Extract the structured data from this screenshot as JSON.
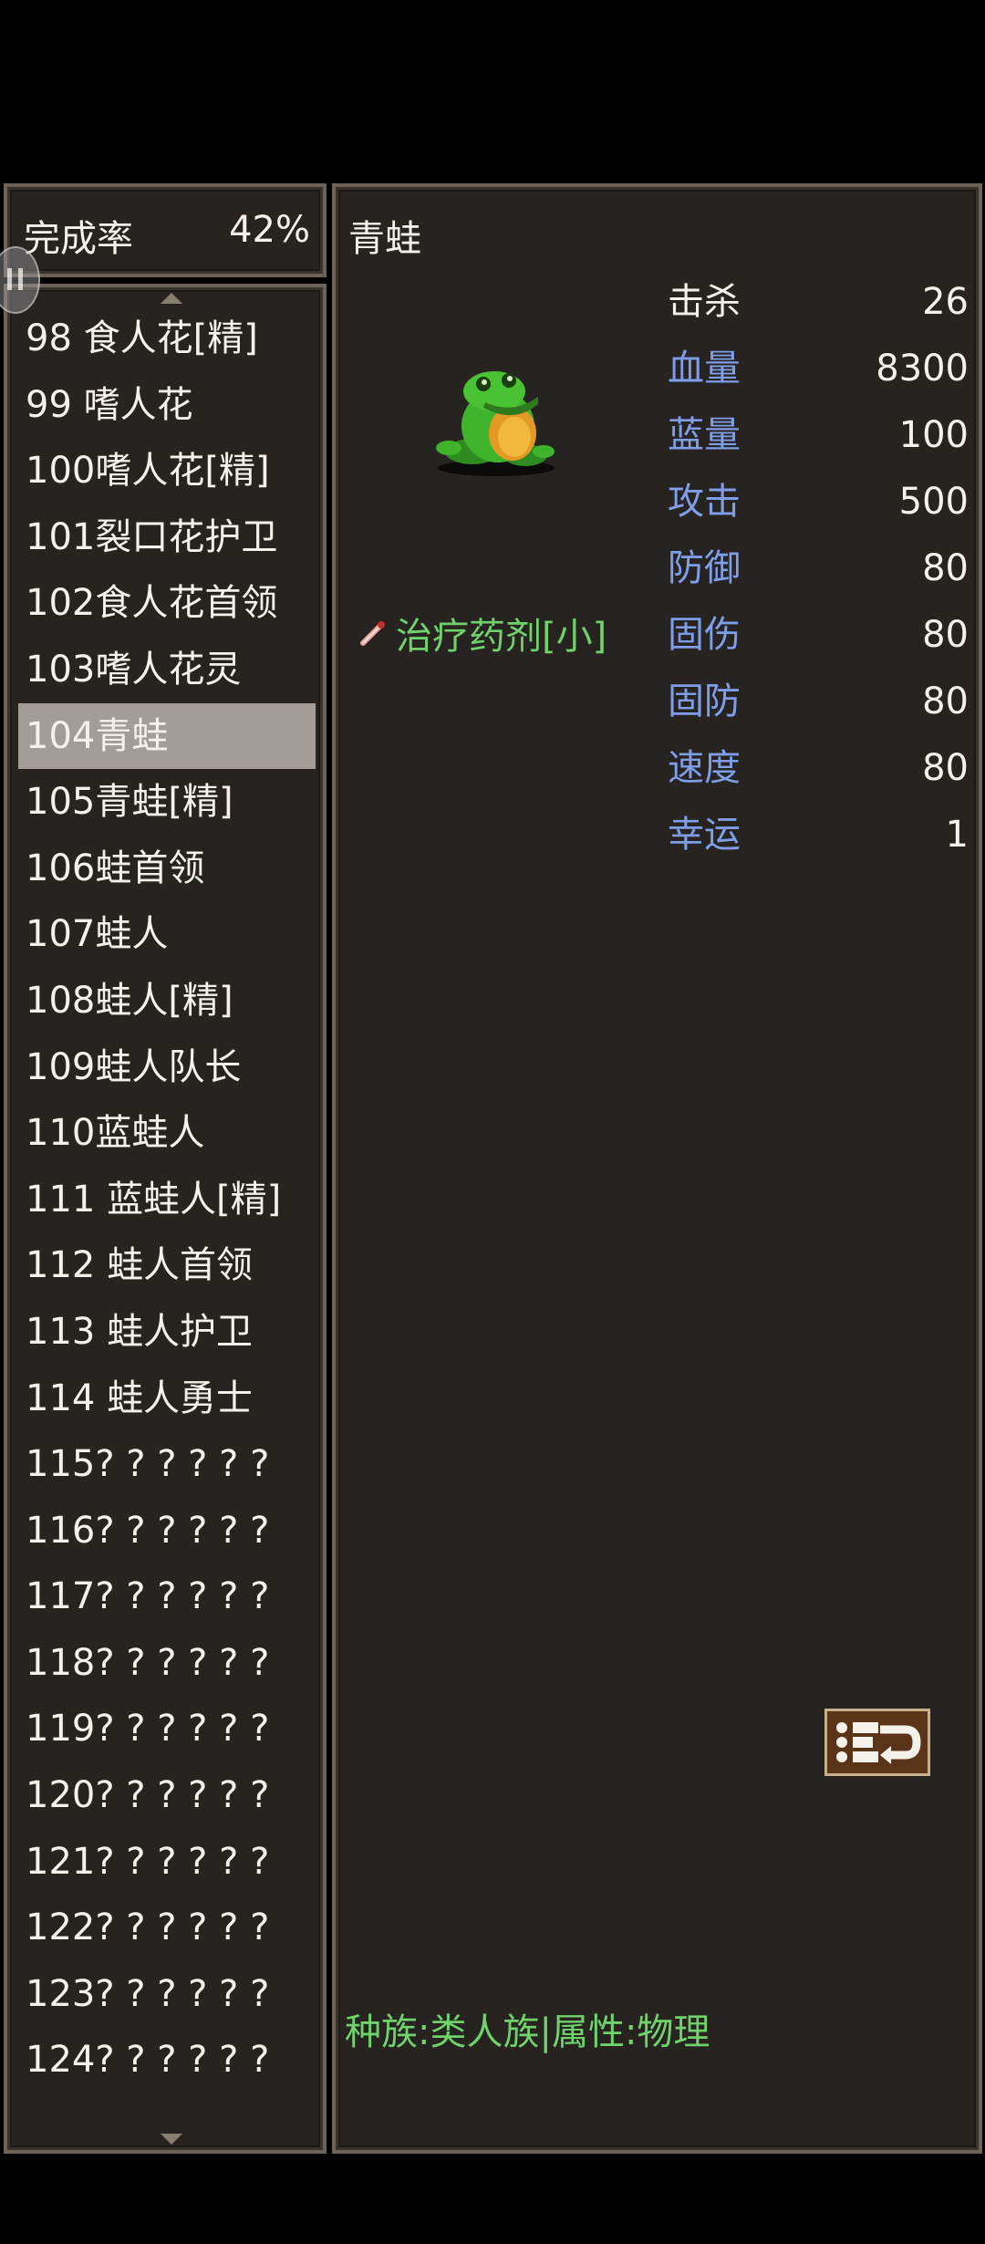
{
  "completion": {
    "label": "完成率",
    "value": "42%"
  },
  "monster_list": [
    "98 食人花[精]",
    "99 嗜人花",
    "100嗜人花[精]",
    "101裂口花护卫",
    "102食人花首领",
    "103嗜人花灵",
    "104青蛙",
    "105青蛙[精]",
    "106蛙首领",
    "107蛙人",
    "108蛙人[精]",
    "109蛙人队长",
    "110蓝蛙人",
    "111 蓝蛙人[精]",
    "112 蛙人首领",
    "113 蛙人护卫",
    "114 蛙人勇士",
    "115? ? ? ? ? ?",
    "116? ? ? ? ? ?",
    "117? ? ? ? ? ?",
    "118? ? ? ? ? ?",
    "119? ? ? ? ? ?",
    "120? ? ? ? ? ?",
    "121? ? ? ? ? ?",
    "122? ? ? ? ? ?",
    "123? ? ? ? ? ?",
    "124? ? ? ? ? ?"
  ],
  "selected_index": 6,
  "detail": {
    "name": "青蛙",
    "drop_item": "治疗药剂[小]",
    "drop_icon": "potion-icon",
    "sprite": "frog-sprite",
    "stats": [
      {
        "label": "击杀",
        "value": "26"
      },
      {
        "label": "血量",
        "value": "8300"
      },
      {
        "label": "蓝量",
        "value": "100"
      },
      {
        "label": "攻击",
        "value": "500"
      },
      {
        "label": "防御",
        "value": "80"
      },
      {
        "label": "固伤",
        "value": "80"
      },
      {
        "label": "固防",
        "value": "80"
      },
      {
        "label": "速度",
        "value": "80"
      },
      {
        "label": "幸运",
        "value": "1"
      }
    ],
    "race_info": "种族:类人族|属性:物理"
  },
  "colors": {
    "label_blue": "#7f9ee8",
    "drop_green": "#6fd26a",
    "selection": "#a39c97",
    "panel_bg": "#272321"
  }
}
